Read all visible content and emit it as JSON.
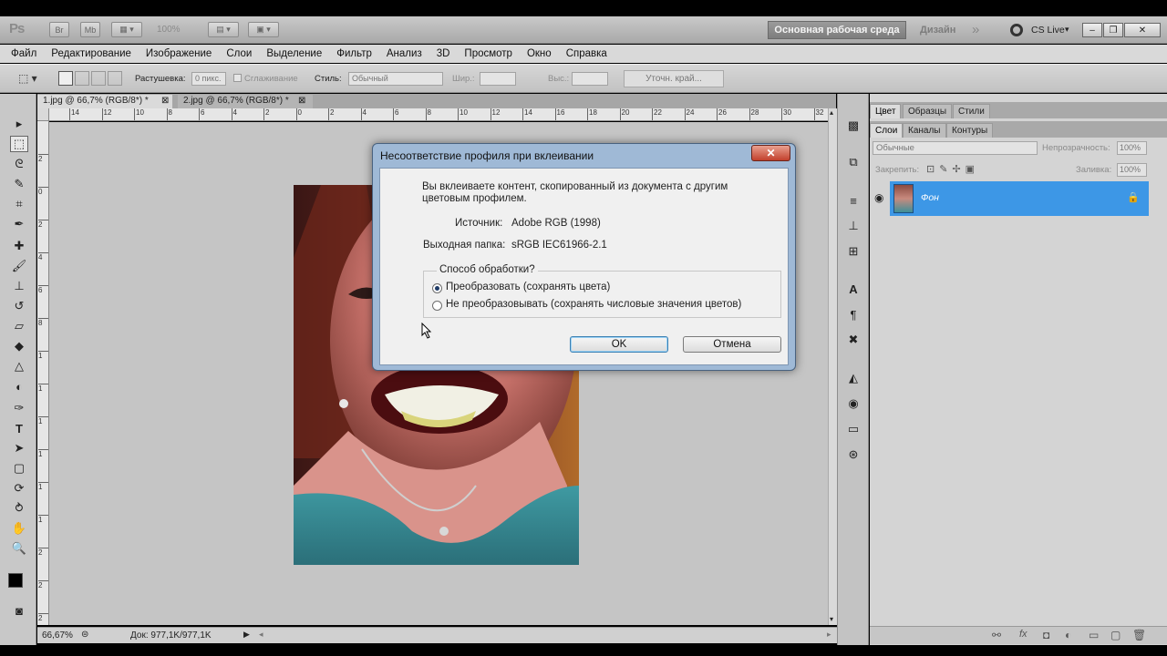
{
  "app": {
    "logo": "Ps",
    "br_label": "Br",
    "mb_label": "Mb",
    "zoom_display": "100%",
    "workspace_button": "Основная рабочая среда",
    "design_label": "Дизайн",
    "more": "»",
    "cs_live": "CS Live"
  },
  "menubar": {
    "items": [
      "Файл",
      "Редактирование",
      "Изображение",
      "Слои",
      "Выделение",
      "Фильтр",
      "Анализ",
      "3D",
      "Просмотр",
      "Окно",
      "Справка"
    ]
  },
  "options": {
    "feather_label": "Растушевка:",
    "feather_value": "0 пикс.",
    "antialias_label": "Сглаживание",
    "style_label": "Стиль:",
    "style_value": "Обычный",
    "width_label": "Шир.:",
    "height_label": "Выс.:",
    "refine_edge_button": "Уточн. край..."
  },
  "tabs": [
    {
      "label": "1.jpg @ 66,7% (RGB/8*) *"
    },
    {
      "label": "2.jpg @ 66,7% (RGB/8*) *"
    }
  ],
  "ruler": {
    "h_ticks": [
      "14",
      "12",
      "10",
      "8",
      "6",
      "4",
      "2",
      "0",
      "2",
      "4",
      "6",
      "8",
      "10",
      "12",
      "14",
      "16",
      "18",
      "20",
      "22",
      "24",
      "26",
      "28",
      "30",
      "32"
    ],
    "v_ticks": [
      "2",
      "0",
      "2",
      "4",
      "6",
      "8",
      "1",
      "1",
      "1",
      "1",
      "1",
      "1",
      "2",
      "2",
      "2"
    ]
  },
  "statusbar": {
    "zoom": "66,67%",
    "doc_info": "Док: 977,1K/977,1K"
  },
  "panels": {
    "top_tabs": [
      "Цвет",
      "Образцы",
      "Стили"
    ],
    "layer_tabs": [
      "Слои",
      "Каналы",
      "Контуры"
    ],
    "blend_mode": "Обычные",
    "opacity_label": "Непрозрачность:",
    "opacity_value": "100%",
    "lock_label": "Закрепить:",
    "fill_label": "Заливка:",
    "fill_value": "100%",
    "layer_name": "Фон"
  },
  "dialog": {
    "title": "Несоответствие профиля при вклеивании",
    "close": "✕",
    "message_line1": "Вы вклеиваете контент, скопированный из документа с другим",
    "message_line2": "цветовым профилем.",
    "source_label": "Источник:",
    "source_value": "Adobe RGB (1998)",
    "dest_label": "Выходная папка:",
    "dest_value": "sRGB IEC61966-2.1",
    "group_label": "Способ обработки?",
    "option_convert": "Преобразовать (сохранять цвета)",
    "option_keep": "Не преобразовывать (сохранять числовые значения цветов)",
    "selected_option": "convert",
    "ok_button": "OK",
    "cancel_button": "Отмена"
  },
  "colors": {
    "selection_blue": "#3d97e6",
    "dialog_frame": "#9fb9d6",
    "canvas_bg": "#c5c5c5"
  }
}
